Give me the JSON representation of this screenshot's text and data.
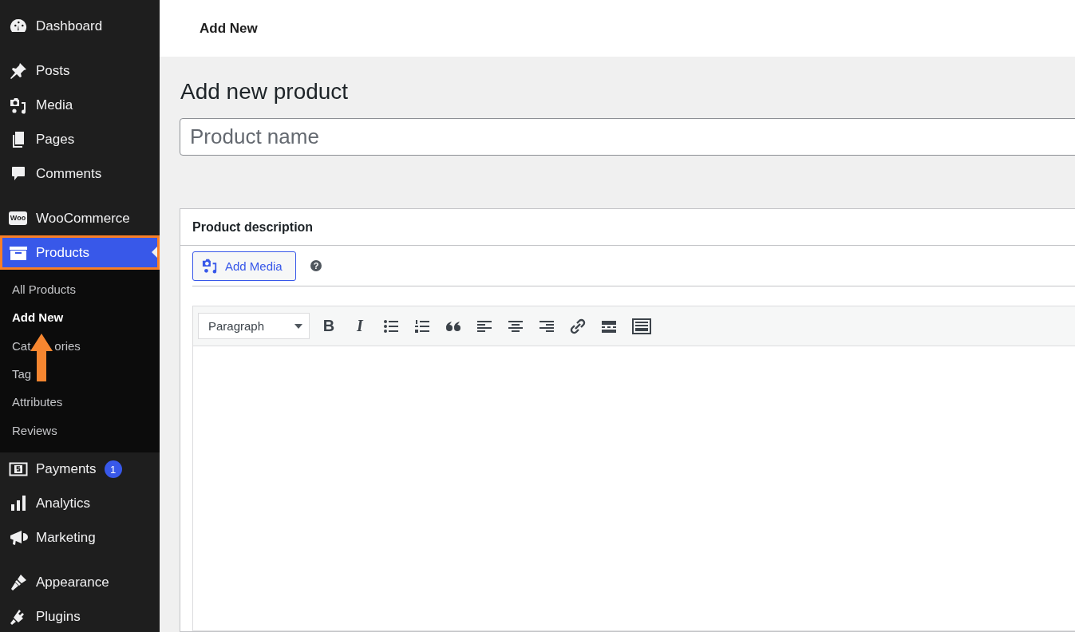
{
  "sidebar": {
    "groups": [
      [
        {
          "label": "Dashboard",
          "selected": false
        }
      ],
      [
        {
          "label": "Posts",
          "selected": false
        },
        {
          "label": "Media",
          "selected": false
        },
        {
          "label": "Pages",
          "selected": false
        },
        {
          "label": "Comments",
          "selected": false
        }
      ],
      [
        {
          "label": "WooCommerce",
          "selected": false,
          "logo_text": "Woo"
        },
        {
          "label": "Products",
          "selected": true,
          "children": [
            {
              "label": "All Products",
              "selected": false
            },
            {
              "label": "Add New",
              "selected": true
            },
            {
              "label": "Cat",
              "label_after": "ories",
              "selected": false
            },
            {
              "label": "Tag",
              "selected": false
            },
            {
              "label": "Attributes",
              "selected": false
            },
            {
              "label": "Reviews",
              "selected": false
            }
          ]
        },
        {
          "label": "Payments",
          "selected": false,
          "badge": "1"
        },
        {
          "label": "Analytics",
          "selected": false
        },
        {
          "label": "Marketing",
          "selected": false
        }
      ],
      [
        {
          "label": "Appearance",
          "selected": false
        },
        {
          "label": "Plugins",
          "selected": false
        }
      ]
    ]
  },
  "top_bar": {
    "title": "Add New"
  },
  "page": {
    "heading": "Add new product",
    "title_field": {
      "placeholder": "Product name"
    }
  },
  "description": {
    "title": "Product description",
    "add_media": "Add Media",
    "help": "?",
    "format_select": "Paragraph",
    "toolbar": [
      {
        "kind": "bold",
        "label": "B"
      },
      {
        "kind": "italic",
        "label": "I"
      },
      {
        "kind": "bullets"
      },
      {
        "kind": "numbers"
      },
      {
        "kind": "quote"
      },
      {
        "kind": "align-left"
      },
      {
        "kind": "align-center"
      },
      {
        "kind": "align-right"
      },
      {
        "kind": "link"
      },
      {
        "kind": "more"
      },
      {
        "kind": "kitchen-sink"
      }
    ]
  }
}
